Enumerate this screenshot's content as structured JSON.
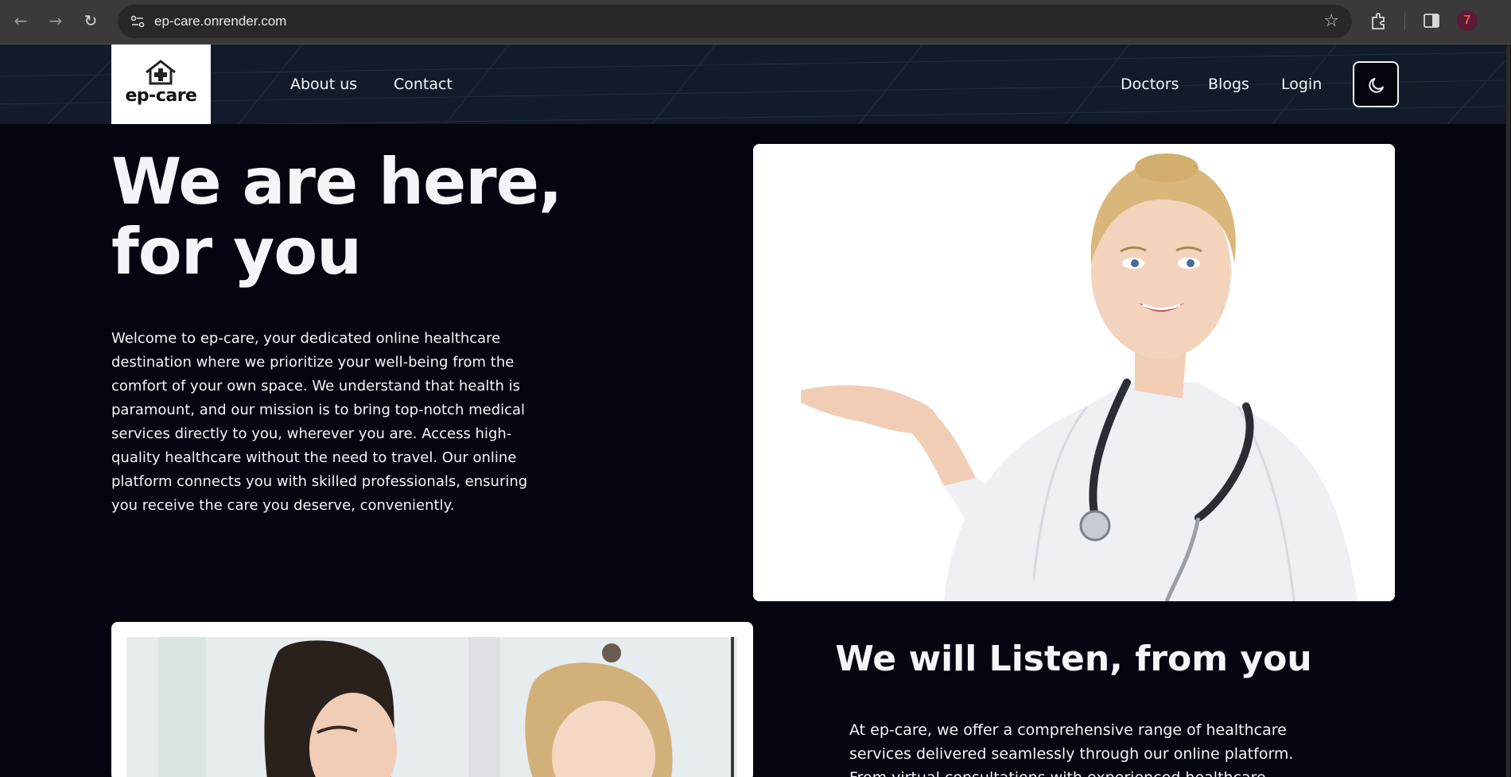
{
  "browser": {
    "url": "ep-care.onrender.com",
    "back_icon": "arrow-left",
    "forward_icon": "arrow-right",
    "reload_icon": "reload",
    "profile_initial": "7"
  },
  "header": {
    "logo_text": "ep-care",
    "nav_left": [
      "About us",
      "Contact"
    ],
    "nav_right": [
      "Doctors",
      "Blogs",
      "Login"
    ],
    "theme_toggle_icon": "moon-icon"
  },
  "hero": {
    "title_line1": "We are here,",
    "title_line2": "for you",
    "paragraph": "Welcome to ep-care, your dedicated online healthcare destination where we prioritize your well-being from the comfort of your own space. We understand that health is paramount, and our mission is to bring top-notch medical services directly to you, wherever you are. Access high-quality healthcare without the need to travel. Our online platform connects you with skilled professionals, ensuring you receive the care you deserve, conveniently."
  },
  "section2": {
    "title": "We will Listen, from you",
    "paragraph": "At ep-care, we offer a comprehensive range of healthcare services delivered seamlessly through our online platform. From virtual consultations with experienced healthcare professionals"
  },
  "colors": {
    "page_bg": "#03060f",
    "header_bg": "#131b2b",
    "text": "#f4f5f8"
  }
}
